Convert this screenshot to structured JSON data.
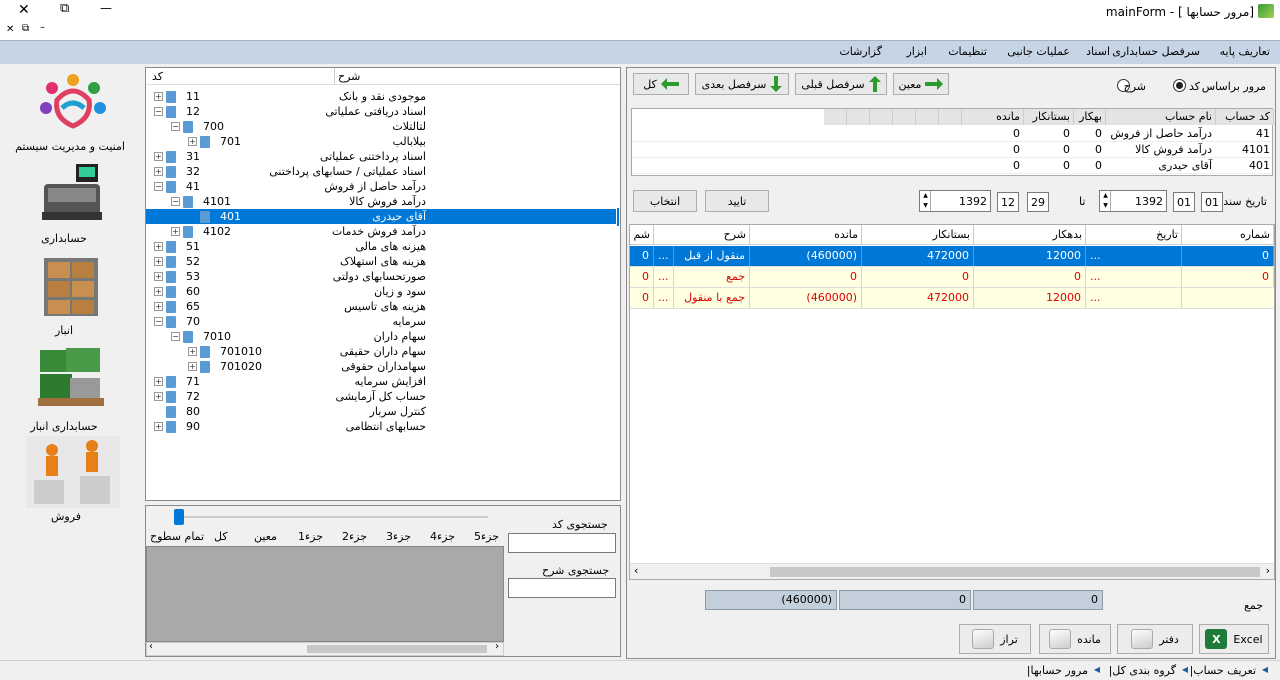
{
  "window": {
    "title": "mainForm - [ مرور حسابها]",
    "controls": {
      "close": "✕",
      "restore": "⧉",
      "minimize": "—",
      "sub_close": "✕",
      "sub_restore": "⧉",
      "sub_min": "–"
    }
  },
  "menu": [
    "تعاریف پایه",
    "سرفصل حسابداری",
    "اسناد",
    "عملیات جانبی",
    "تنظیمات",
    "ابزار",
    "گزارشات"
  ],
  "sidebar": {
    "items": [
      {
        "label": "امنیت و مدیریت سیستم",
        "icon": "people-logo-icon"
      },
      {
        "label": "حسابداری",
        "icon": "cash-register-icon"
      },
      {
        "label": "انبار",
        "icon": "boxes-icon"
      },
      {
        "label": "حسابداری انبار",
        "icon": "cash-boxes-icon"
      },
      {
        "label": "فروش",
        "icon": "sales-people-icon"
      }
    ]
  },
  "tree": {
    "headers": {
      "code": "کد",
      "desc": "شرح"
    },
    "rows": [
      {
        "code": "11",
        "name": "موجودی نقد و بانک",
        "level": 0,
        "sign": "+"
      },
      {
        "code": "12",
        "name": "اسناد دریافتی عملیاتی",
        "level": 0,
        "sign": "-"
      },
      {
        "code": "700",
        "name": "لتالتلات",
        "level": 1,
        "sign": "-"
      },
      {
        "code": "701",
        "name": "بیلابالب",
        "level": 2,
        "sign": "+"
      },
      {
        "code": "31",
        "name": "اسناد پرداختنی عملیاتی",
        "level": 0,
        "sign": "+"
      },
      {
        "code": "32",
        "name": "اسناد عملیاتی / حسابهای پرداختنی",
        "level": 0,
        "sign": "+"
      },
      {
        "code": "41",
        "name": "درآمد حاصل از فروش",
        "level": 0,
        "sign": "-"
      },
      {
        "code": "4101",
        "name": "درآمد فروش کالا",
        "level": 1,
        "sign": "-"
      },
      {
        "code": "401",
        "name": "آقای حیدری",
        "level": 2,
        "sign": "",
        "selected": true
      },
      {
        "code": "4102",
        "name": "درآمد فروش خدمات",
        "level": 1,
        "sign": "+"
      },
      {
        "code": "51",
        "name": "هیزنه های مالی",
        "level": 0,
        "sign": "+"
      },
      {
        "code": "52",
        "name": "هزینه های استهلاک",
        "level": 0,
        "sign": "+"
      },
      {
        "code": "53",
        "name": "صورتحسابهای دولتی",
        "level": 0,
        "sign": "+"
      },
      {
        "code": "60",
        "name": "سود و زیان",
        "level": 0,
        "sign": "+"
      },
      {
        "code": "65",
        "name": "هزینه های تاسیس",
        "level": 0,
        "sign": "+"
      },
      {
        "code": "70",
        "name": "سرمایه",
        "level": 0,
        "sign": "-"
      },
      {
        "code": "7010",
        "name": "سهام داران",
        "level": 1,
        "sign": "-"
      },
      {
        "code": "701010",
        "name": "سهام داران حقیقی",
        "level": 2,
        "sign": "+"
      },
      {
        "code": "701020",
        "name": "سهامداران حقوقی",
        "level": 2,
        "sign": "+"
      },
      {
        "code": "71",
        "name": "افزایش سرمایه",
        "level": 0,
        "sign": "+"
      },
      {
        "code": "72",
        "name": "حساب کل آزمایشی",
        "level": 0,
        "sign": "+"
      },
      {
        "code": "80",
        "name": "کنترل سربار",
        "level": 0,
        "sign": ""
      },
      {
        "code": "90",
        "name": "حسابهای انتظامی",
        "level": 0,
        "sign": "+"
      }
    ]
  },
  "search": {
    "code_label": "جستجوی کد",
    "desc_label": "جستجوی شرح",
    "levels": [
      "جزء5",
      "جزء4",
      "جزء3",
      "جزء2",
      "جزء1",
      "معین",
      "کل",
      "تمام سطوح"
    ],
    "slider_level": 0
  },
  "toolbar": {
    "browse_by": "مرور براساس",
    "radio_code": "کد",
    "radio_desc": "شرح",
    "selected": "code",
    "btn_moein": "معین",
    "btn_prev": "سرفصل قبلی",
    "btn_next": "سرفصل بعدی",
    "btn_kol": "کل"
  },
  "accounts": {
    "headers": [
      "کد حساب",
      "نام حساب",
      "بهکار",
      "بستانکار",
      "مانده"
    ],
    "rows": [
      [
        "41",
        "درآمد حاصل از فروش",
        "0",
        "0",
        "0"
      ],
      [
        "4101",
        "درآمد فروش کالا",
        "0",
        "0",
        "0"
      ],
      [
        "401",
        "آقای حیدری",
        "0",
        "0",
        "0"
      ]
    ]
  },
  "dates": {
    "label": "تاریخ سند",
    "from_day": "01",
    "from_month": "01",
    "from_year": "1392",
    "to_label": "تا",
    "to_day": "29",
    "to_month": "12",
    "to_year": "1392",
    "btn_confirm": "تایید",
    "btn_select": "انتخاب"
  },
  "grid": {
    "headers": [
      "شماره",
      "تاریخ",
      "بدهکار",
      "بستانکار",
      "مانده",
      "شرح",
      "شم"
    ],
    "rows": [
      {
        "num": "0",
        "date": "...",
        "debit": "12000",
        "credit": "472000",
        "balance": "(460000)",
        "desc": "منقول از قبل",
        "dots": "...",
        "last": "0",
        "style": "selected"
      },
      {
        "num": "0",
        "date": "...",
        "debit": "0",
        "credit": "0",
        "balance": "0",
        "desc": "جمع",
        "dots": "...",
        "last": "0",
        "style": "sum"
      },
      {
        "num": "",
        "date": "...",
        "debit": "12000",
        "credit": "472000",
        "balance": "(460000)",
        "desc": "جمع با منقول",
        "dots": "...",
        "last": "0",
        "style": "sum"
      }
    ]
  },
  "totals": {
    "label": "جمع",
    "debit": "0",
    "credit": "0",
    "balance": "(460000)"
  },
  "actions": {
    "excel": "Excel",
    "daftar": "دفتر",
    "mande": "مانده",
    "taraz": "تراز"
  },
  "status": {
    "crumbs": [
      "|تعریف حساب",
      "|گروه بندی کل",
      "|مرور حسابها"
    ]
  },
  "colors": {
    "selection": "#0078d7",
    "sum_row": "#ffffe1",
    "menu_bg": "#c6d5e6",
    "red_text": "#e00000"
  }
}
